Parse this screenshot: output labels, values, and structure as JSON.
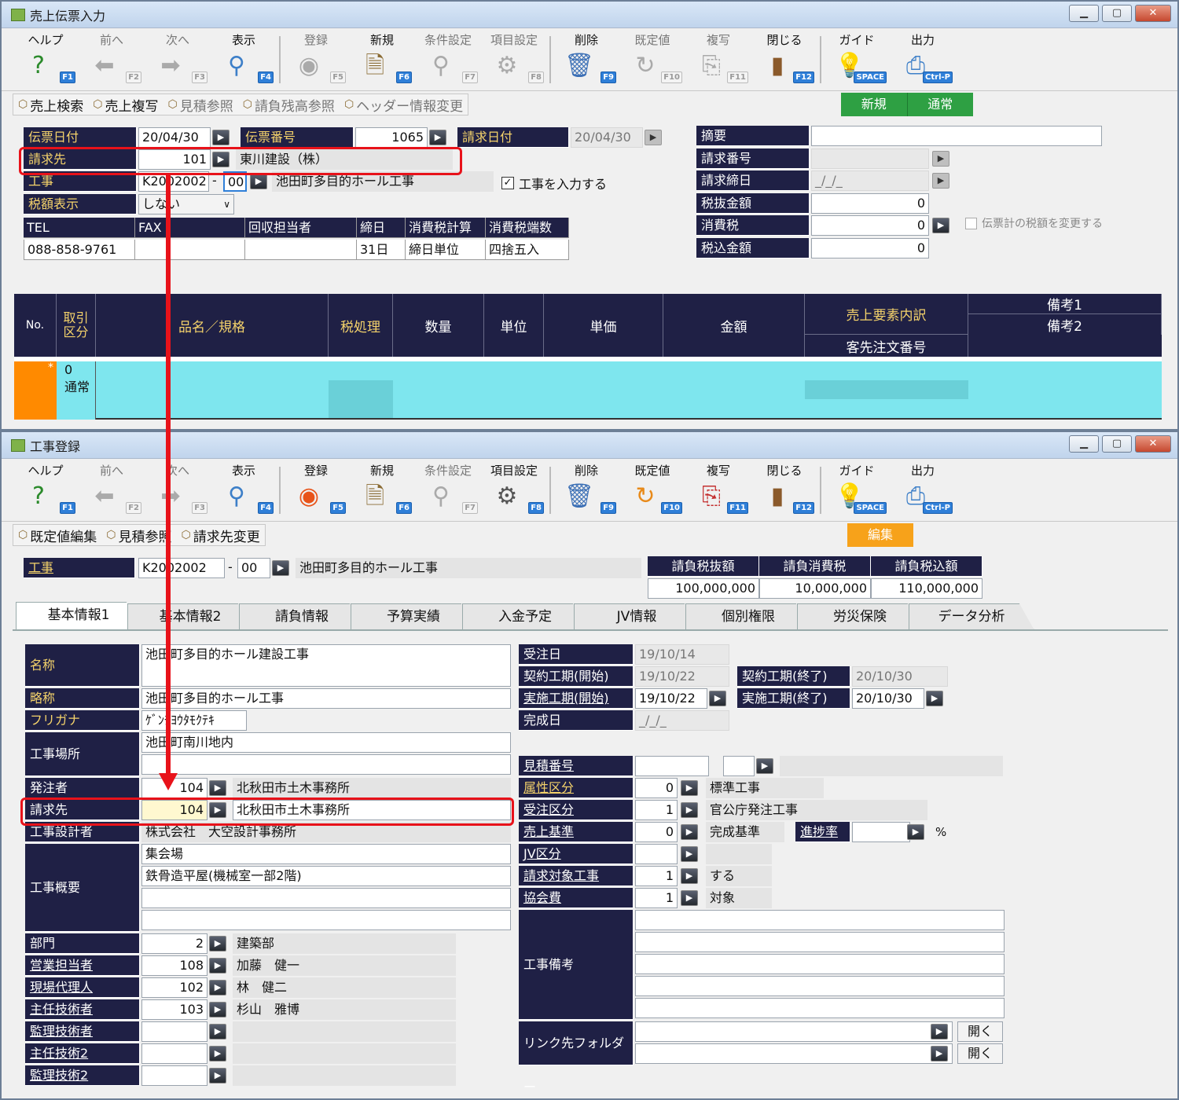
{
  "w1": {
    "title": "売上伝票入力",
    "toolbar": [
      {
        "label": "ヘルプ",
        "key": "F1",
        "icon": "help-icon",
        "dis": false
      },
      {
        "label": "前へ",
        "key": "F2",
        "icon": "arrow-left-icon",
        "dis": true
      },
      {
        "label": "次へ",
        "key": "F3",
        "icon": "arrow-right-icon",
        "dis": true
      },
      {
        "label": "表示",
        "key": "F4",
        "icon": "magnifier-icon",
        "dis": false
      },
      {
        "label": "登録",
        "key": "F5",
        "icon": "ok-icon",
        "dis": true
      },
      {
        "label": "新規",
        "key": "F6",
        "icon": "new-doc-icon",
        "dis": false
      },
      {
        "label": "条件設定",
        "key": "F7",
        "icon": "filter-icon",
        "dis": true
      },
      {
        "label": "項目設定",
        "key": "F8",
        "icon": "settings-icon",
        "dis": true
      },
      {
        "label": "削除",
        "key": "F9",
        "icon": "trash-icon",
        "dis": false
      },
      {
        "label": "既定値",
        "key": "F10",
        "icon": "refresh-icon",
        "dis": true
      },
      {
        "label": "複写",
        "key": "F11",
        "icon": "copy-icon",
        "dis": true
      },
      {
        "label": "閉じる",
        "key": "F12",
        "icon": "door-icon",
        "dis": false
      },
      {
        "label": "ガイド",
        "key": "SPACE",
        "icon": "bulb-icon",
        "dis": false
      },
      {
        "label": "出力",
        "key": "Ctrl-P",
        "icon": "print-icon",
        "dis": false
      }
    ],
    "sub": [
      {
        "label": "売上検索",
        "dis": false
      },
      {
        "label": "売上複写",
        "dis": false
      },
      {
        "label": "見積参照",
        "dis": true
      },
      {
        "label": "請負残高参照",
        "dis": true
      },
      {
        "label": "ヘッダー情報変更",
        "dis": true
      }
    ],
    "mode": [
      "新規",
      "通常"
    ],
    "date_lbl": "伝票日付",
    "date": "20/04/30",
    "no_lbl": "伝票番号",
    "no": "1065",
    "bill_date_lbl": "請求日付",
    "bill_date": "20/04/30",
    "bill_lbl": "請求先",
    "bill_code": "101",
    "bill_name": "東川建設（株）",
    "proj_lbl": "工事",
    "proj_code": "K2002002",
    "proj_sub": "00",
    "proj_name": "池田町多目的ホール工事",
    "proj_check": "工事を入力する",
    "tax_lbl": "税額表示",
    "tax_val": "しない",
    "info_hd": [
      "TEL",
      "FAX",
      "回収担当者",
      "締日",
      "消費税計算",
      "消費税端数"
    ],
    "info_val": [
      "088-858-9761",
      "",
      "",
      "31日",
      "締日単位",
      "四捨五入"
    ],
    "right_lbls": [
      "摘要",
      "請求番号",
      "請求締日",
      "税抜金額",
      "消費税",
      "税込金額"
    ],
    "right_vals": [
      "",
      "",
      "_/_/_",
      "0",
      "0",
      "0"
    ],
    "tax_change": "伝票計の税額を変更する",
    "grid_hd": {
      "no": "No.",
      "kubun": "取引区分",
      "item": "品名／規格",
      "taxp": "税処理",
      "qty": "数量",
      "unit": "単位",
      "price": "単価",
      "amt": "金額",
      "breakdown": "売上要素内訳",
      "order": "客先注文番号",
      "memo1": "備考1",
      "memo2": "備考2"
    },
    "row": {
      "mark": "*",
      "n": "0",
      "kubun": "通常"
    }
  },
  "w2": {
    "title": "工事登録",
    "toolbar": [
      {
        "label": "ヘルプ",
        "key": "F1",
        "icon": "help-icon",
        "dis": false
      },
      {
        "label": "前へ",
        "key": "F2",
        "icon": "arrow-left-icon",
        "dis": true
      },
      {
        "label": "次へ",
        "key": "F3",
        "icon": "arrow-right-icon",
        "dis": true
      },
      {
        "label": "表示",
        "key": "F4",
        "icon": "magnifier-icon",
        "dis": false
      },
      {
        "label": "登録",
        "key": "F5",
        "icon": "ok-icon",
        "dis": false
      },
      {
        "label": "新規",
        "key": "F6",
        "icon": "new-doc-icon",
        "dis": false
      },
      {
        "label": "条件設定",
        "key": "F7",
        "icon": "filter-icon",
        "dis": true
      },
      {
        "label": "項目設定",
        "key": "F8",
        "icon": "settings-icon",
        "dis": false
      },
      {
        "label": "削除",
        "key": "F9",
        "icon": "trash-icon",
        "dis": false
      },
      {
        "label": "既定値",
        "key": "F10",
        "icon": "refresh-icon",
        "dis": false
      },
      {
        "label": "複写",
        "key": "F11",
        "icon": "copy-icon",
        "dis": false
      },
      {
        "label": "閉じる",
        "key": "F12",
        "icon": "door-icon",
        "dis": false
      },
      {
        "label": "ガイド",
        "key": "SPACE",
        "icon": "bulb-icon",
        "dis": false
      },
      {
        "label": "出力",
        "key": "Ctrl-P",
        "icon": "print-icon",
        "dis": false
      }
    ],
    "sub": [
      {
        "label": "既定値編集"
      },
      {
        "label": "見積参照"
      },
      {
        "label": "請求先変更"
      }
    ],
    "mode": "編集",
    "proj_lbl": "工事",
    "proj_code": "K2002002",
    "proj_sub": "00",
    "proj_name": "池田町多目的ホール工事",
    "totals_hd": [
      "請負税抜額",
      "請負消費税",
      "請負税込額"
    ],
    "totals": [
      "100,000,000",
      "10,000,000",
      "110,000,000"
    ],
    "tabs": [
      "基本情報1",
      "基本情報2",
      "請負情報",
      "予算実績",
      "入金予定",
      "JV情報",
      "個別権限",
      "労災保険",
      "データ分析"
    ],
    "f": {
      "name_lbl": "名称",
      "name": "池田町多目的ホール建設工事",
      "short_lbl": "略称",
      "short": "池田町多目的ホール工事",
      "kana_lbl": "フリガナ",
      "kana": "ｹﾞﾝﾁﾖｳﾀﾓｸﾃｷ",
      "site_lbl": "工事場所",
      "site": "池田町南川地内",
      "client_lbl": "発注者",
      "client_code": "104",
      "client_name": "北秋田市土木事務所",
      "bill_lbl": "請求先",
      "bill_code": "104",
      "bill_name": "北秋田市土木事務所",
      "designer_lbl": "工事設計者",
      "designer": "株式会社　大空設計事務所",
      "summary_lbl": "工事概要",
      "summary1": "集会場",
      "summary2": "鉄骨造平屋(機械室一部2階)",
      "dept_lbl": "部門",
      "dept_code": "2",
      "dept_name": "建築部",
      "sales_lbl": "営業担当者",
      "sales_code": "108",
      "sales_name": "加藤　健一",
      "site_agent_lbl": "現場代理人",
      "site_agent_code": "102",
      "site_agent_name": "林　健二",
      "chief_lbl": "主任技術者",
      "chief_code": "103",
      "chief_name": "杉山　雅博",
      "super_lbl": "監理技術者",
      "chief2_lbl": "主任技術2",
      "super2_lbl": "監理技術2"
    },
    "r": {
      "order_date_lbl": "受注日",
      "order_date": "19/10/14",
      "cstart_lbl": "契約工期(開始)",
      "cstart": "19/10/22",
      "cend_lbl": "契約工期(終了)",
      "cend": "20/10/30",
      "astart_lbl": "実施工期(開始)",
      "astart": "19/10/22",
      "aend_lbl": "実施工期(終了)",
      "aend": "20/10/30",
      "done_lbl": "完成日",
      "done": "_/_/_",
      "est_lbl": "見積番号",
      "attr_lbl": "属性区分",
      "attr_code": "0",
      "attr_name": "標準工事",
      "ordtype_lbl": "受注区分",
      "ordtype_code": "1",
      "ordtype_name": "官公庁発注工事",
      "salesbase_lbl": "売上基準",
      "salesbase_code": "0",
      "salesbase_name": "完成基準",
      "progress_lbl": "進捗率",
      "pct": "%",
      "jv_lbl": "JV区分",
      "billtarget_lbl": "請求対象工事",
      "billtarget_code": "1",
      "billtarget_name": "する",
      "assoc_lbl": "協会費",
      "assoc_code": "1",
      "assoc_name": "対象",
      "remarks_lbl": "工事備考",
      "link_lbl": "リンク先フォルダー",
      "open": "開く"
    }
  },
  "colors": {
    "nav": "#1f2045",
    "label_yellow": "#f5d36b",
    "grid_row": "#7ee6ee",
    "red": "#e8121a",
    "green": "#2ea043",
    "orange": "#f7a21a"
  }
}
